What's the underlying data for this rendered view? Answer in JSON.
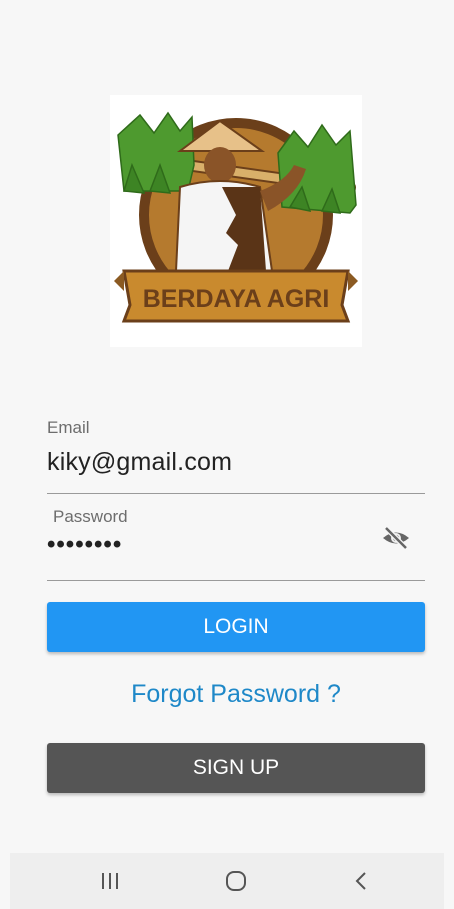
{
  "logo": {
    "text": "BERDAYA AGRI",
    "colors": {
      "banner": "#c98a2e",
      "circle": "#b57a2e",
      "ring": "#6b3f1a",
      "grass": "#4e9a2f",
      "hat": "#e7c189"
    }
  },
  "form": {
    "email": {
      "label": "Email",
      "value": "kiky@gmail.com"
    },
    "password": {
      "label": "Password",
      "value": "••••••••",
      "toggle_icon": "eye-off-icon"
    }
  },
  "buttons": {
    "login_label": "LOGIN",
    "forgot_label": "Forgot Password ?",
    "signup_label": "SIGN UP"
  },
  "colors": {
    "primary": "#2196f3",
    "link": "#1e88c8",
    "secondary": "#555555",
    "background": "#f7f7f7"
  },
  "nav": {
    "recents_icon": "recents-icon",
    "home_icon": "home-icon",
    "back_icon": "back-icon"
  }
}
